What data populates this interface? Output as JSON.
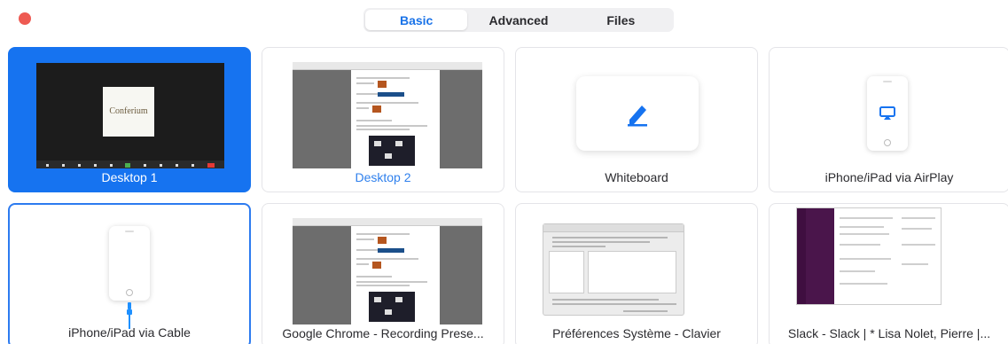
{
  "tabs": [
    {
      "label": "Basic",
      "active": true
    },
    {
      "label": "Advanced",
      "active": false
    },
    {
      "label": "Files",
      "active": false
    }
  ],
  "desktop1": {
    "label": "Desktop 1",
    "logo_text": "Conferium"
  },
  "desktop2": {
    "label": "Desktop 2"
  },
  "whiteboard": {
    "label": "Whiteboard",
    "icon": "pen-icon"
  },
  "airplay": {
    "label": "iPhone/iPad via AirPlay",
    "icon": "airplay-icon"
  },
  "cable": {
    "label": "iPhone/iPad via Cable",
    "icon": "lightning-cable-icon"
  },
  "chrome": {
    "label": "Google Chrome - Recording Prese..."
  },
  "prefs": {
    "label": "Préférences Système - Clavier"
  },
  "slack": {
    "label": "Slack - Slack | * Lisa Nolet, Pierre |..."
  },
  "colors": {
    "accent": "#1673f0",
    "close": "#ee5a52"
  }
}
